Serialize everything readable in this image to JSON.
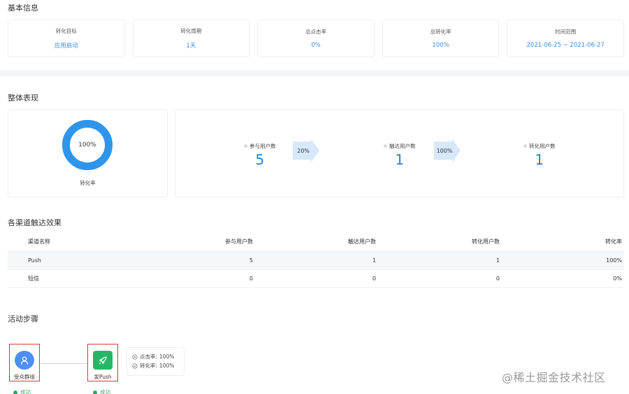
{
  "basic_info": {
    "title": "基本信息",
    "cards": [
      {
        "label": "转化目标",
        "value": "应用启动"
      },
      {
        "label": "转化周期",
        "value": "1天"
      },
      {
        "label": "总点击率",
        "value": "0%"
      },
      {
        "label": "总转化率",
        "value": "100%"
      },
      {
        "label": "时间范围",
        "value": "2021-06-25 ~ 2021-06-27"
      }
    ]
  },
  "overall": {
    "title": "整体表现",
    "donut": {
      "value_text": "100%",
      "fraction": 1.0,
      "caption": "转化率",
      "color": "#2e95ea"
    },
    "metrics": [
      {
        "label": "参与用户数",
        "value": "5"
      },
      {
        "label": "触达用户数",
        "value": "1"
      },
      {
        "label": "转化用户数",
        "value": "1"
      }
    ],
    "arrows": [
      "20%",
      "100%"
    ]
  },
  "channels": {
    "title": "各渠道触达效果",
    "headers": [
      "渠道名称",
      "参与用户数",
      "触达用户数",
      "转化用户数",
      "转化率"
    ],
    "rows": [
      [
        "Push",
        "5",
        "1",
        "1",
        "100%"
      ],
      [
        "短信",
        "0",
        "0",
        "0",
        "0%"
      ]
    ]
  },
  "steps": {
    "title": "活动步骤",
    "nodes": [
      {
        "label": "受众群组",
        "icon": "user-group-icon",
        "color": "#4c8ff7",
        "status": "成功"
      },
      {
        "label": "发Push",
        "icon": "rocket-icon",
        "color": "#25b864",
        "status": "成功"
      }
    ],
    "stats": [
      {
        "label": "点击率:",
        "value": "100%"
      },
      {
        "label": "转化率:",
        "value": "100%"
      }
    ]
  },
  "watermark": "@稀土掘金技术社区"
}
